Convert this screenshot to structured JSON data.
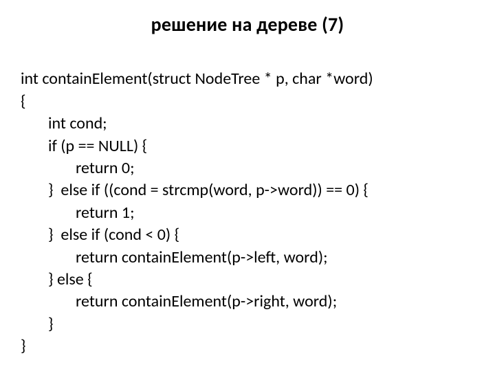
{
  "title": "решение на дереве (7)",
  "code": {
    "l01": "int containElement(struct NodeTree * p, char *word)",
    "l02": "{",
    "l03": "int cond;",
    "l04": "if (p == NULL) {",
    "l05": "return 0;",
    "l06": "}  else if ((cond = strcmp(word, p->word)) == 0) {",
    "l07": "return 1;",
    "l08": "}  else if (cond < 0) {",
    "l09": "return containElement(p->left, word);",
    "l10": "} else {",
    "l11": "return containElement(p->right, word);",
    "l12": "}",
    "l13": "}"
  }
}
